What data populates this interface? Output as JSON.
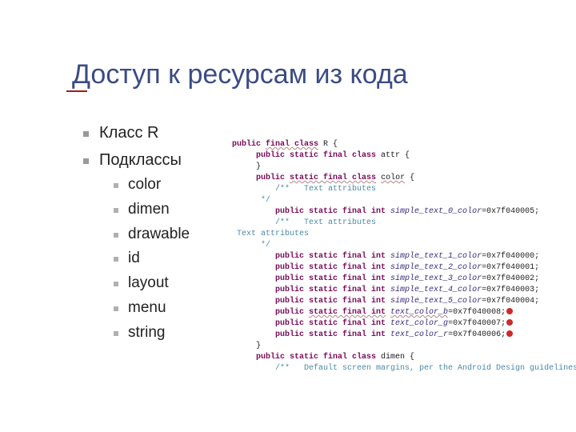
{
  "title": "Доступ к ресурсам из кода",
  "bullets": {
    "b1": "Класс R",
    "b2": "Подклассы",
    "sub": {
      "s1": "color",
      "s2": "dimen",
      "s3": "drawable",
      "s4": "id",
      "s5": "layout",
      "s6": "menu",
      "s7": "string"
    }
  },
  "code": {
    "l01a": "public ",
    "l01b": "final class",
    "l01c": " R {",
    "l02a": "     public static final class",
    "l02b": " attr {",
    "l03": "     }",
    "l04a": "     public ",
    "l04b": "static final class",
    "l04c": " ",
    "l04d": "color",
    "l04e": " {",
    "l05": "         /**   Text attributes",
    "l06": "      */",
    "l07a": "         public static final int ",
    "l07b": "simple_text_0_color",
    "l07c": "=0x7f040005;",
    "l08": "         /**   Text attributes",
    "l09": " Text attributes",
    "l10": "      */",
    "l11a": "         public static final int ",
    "l11b": "simple_text_1_color",
    "l11c": "=0x7f040000;",
    "l12a": "         public static final int ",
    "l12b": "simple_text_2_color",
    "l12c": "=0x7f040001;",
    "l13a": "         public static final int ",
    "l13b": "simple_text_3_color",
    "l13c": "=0x7f040002;",
    "l14a": "         public static final int ",
    "l14b": "simple_text_4_color",
    "l14c": "=0x7f040003;",
    "l15a": "         public static final int ",
    "l15b": "simple_text_5_color",
    "l15c": "=0x7f040004;",
    "l16a": "         public ",
    "l16b": "static final int",
    "l16c": " ",
    "l16d": "text_color_b",
    "l16e": "=0x7f040008;",
    "l17a": "         public static final int ",
    "l17b": "text_color_g",
    "l17c": "=0x7f040007;",
    "l18a": "         public static final int ",
    "l18b": "text_color_r",
    "l18c": "=0x7f040006;",
    "l19": "     }",
    "l20a": "     public static final class",
    "l20b": " dimen {",
    "l21": "         /**   Default screen margins, per the Android Design guidelines."
  }
}
